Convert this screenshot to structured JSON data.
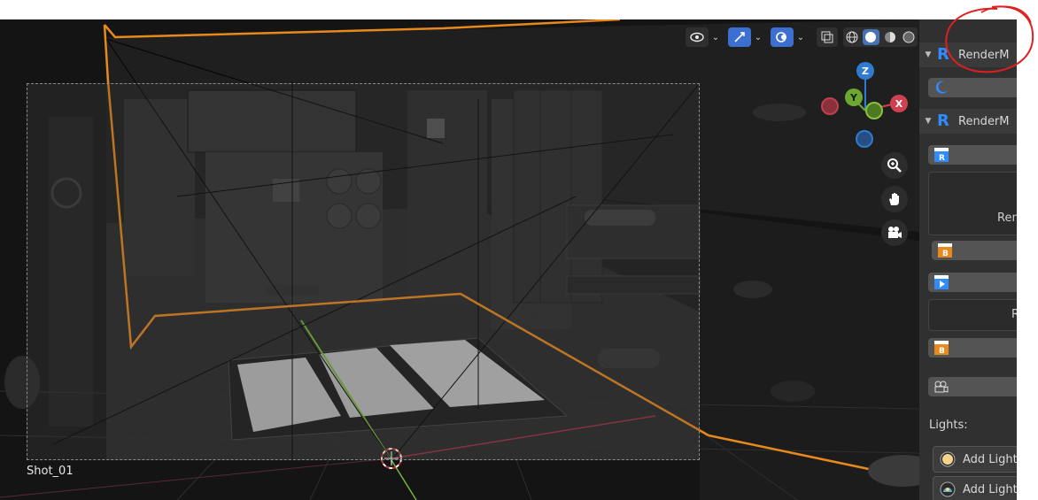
{
  "viewport": {
    "camera_label": "Shot_01",
    "axes": {
      "z": "Z",
      "y": "Y",
      "x": "X"
    }
  },
  "header_icons": [
    "visibility-icon",
    "gizmo-icon",
    "overlay-icon",
    "xray-icon",
    "wireframe-shading-icon",
    "solid-shading-icon",
    "material-shading-icon",
    "rendered-shading-icon",
    "render-clapper-icon"
  ],
  "nav_icons": [
    "zoom-icon",
    "hand-pan-icon",
    "camera-view-icon"
  ],
  "panel": {
    "section1_title": "RenderM",
    "section2_title": "RenderM",
    "render_button_text": "Ren",
    "render_button_text2": "R",
    "lights_label": "Lights:",
    "add_light_1": "Add Light",
    "add_light_2": "Add Light"
  },
  "annotation": {
    "color": "#e02020",
    "description_icon": "red-circle-annotation"
  },
  "colors": {
    "accent_orange": "#e8891d",
    "blue_button": "#3d6fd1",
    "panel_bg": "#303030"
  }
}
